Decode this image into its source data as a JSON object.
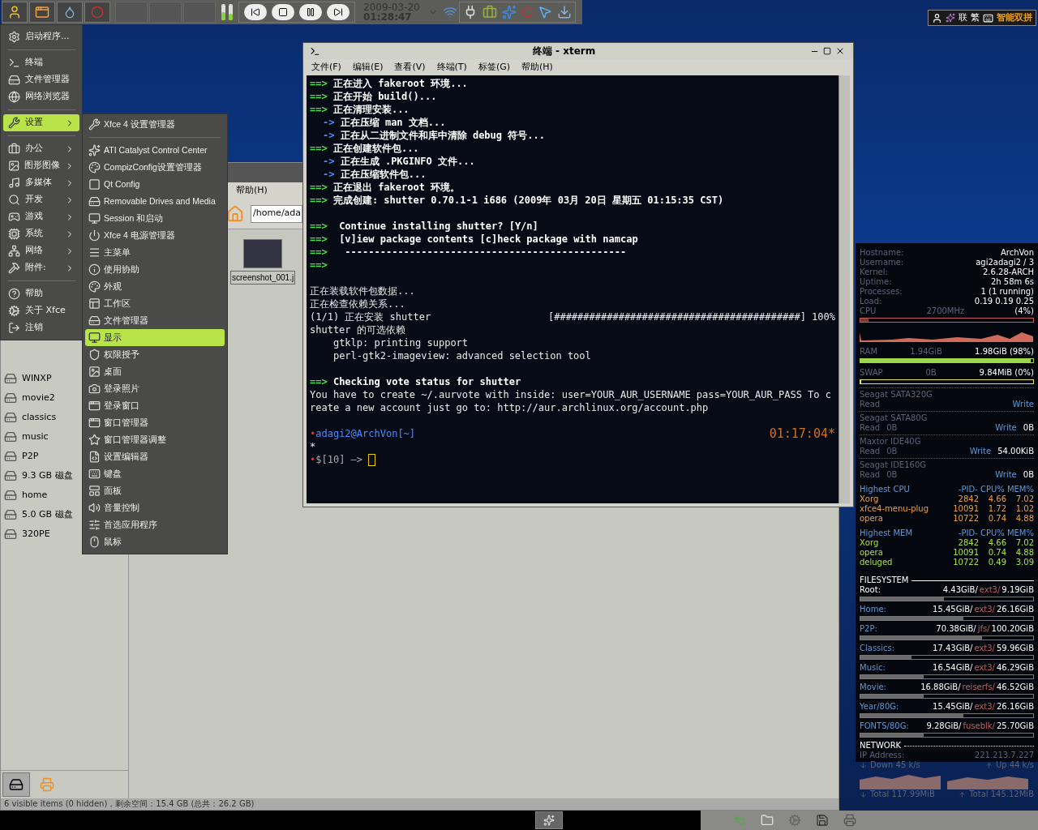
{
  "top_panel": {
    "date": "2009-03-20",
    "time": "01:28:47",
    "ime": {
      "chars": [
        "联",
        "繁"
      ],
      "mode": "智能双拼"
    }
  },
  "app_menu": {
    "items": [
      {
        "kind": "item",
        "label": "启动程序...",
        "selected": false,
        "submenu": false
      },
      {
        "kind": "separator"
      },
      {
        "kind": "item",
        "label": "终端",
        "selected": false,
        "submenu": false
      },
      {
        "kind": "item",
        "label": "文件管理器",
        "selected": false,
        "submenu": false
      },
      {
        "kind": "item",
        "label": "网络浏览器",
        "selected": false,
        "submenu": false
      },
      {
        "kind": "separator"
      },
      {
        "kind": "item",
        "label": "设置",
        "selected": true,
        "submenu": true
      },
      {
        "kind": "separator"
      },
      {
        "kind": "item",
        "label": "办公",
        "selected": false,
        "submenu": true
      },
      {
        "kind": "item",
        "label": "图形图像",
        "selected": false,
        "submenu": true
      },
      {
        "kind": "item",
        "label": "多媒体",
        "selected": false,
        "submenu": true
      },
      {
        "kind": "item",
        "label": "开发",
        "selected": false,
        "submenu": true
      },
      {
        "kind": "item",
        "label": "游戏",
        "selected": false,
        "submenu": true
      },
      {
        "kind": "item",
        "label": "系统",
        "selected": false,
        "submenu": true
      },
      {
        "kind": "item",
        "label": "网络",
        "selected": false,
        "submenu": true
      },
      {
        "kind": "item",
        "label": "附件:",
        "selected": false,
        "submenu": true
      },
      {
        "kind": "separator"
      },
      {
        "kind": "item",
        "label": "帮助",
        "selected": false,
        "submenu": false
      },
      {
        "kind": "item",
        "label": "关于 Xfce",
        "selected": false,
        "submenu": false
      },
      {
        "kind": "item",
        "label": "注销",
        "selected": false,
        "submenu": false
      }
    ]
  },
  "settings_menu": {
    "items": [
      {
        "kind": "item",
        "label": "Xfce 4 设置管理器",
        "selected": false
      },
      {
        "kind": "separator"
      },
      {
        "kind": "item",
        "label": "ATI Catalyst Control Center",
        "selected": false
      },
      {
        "kind": "item",
        "label": "CompizConfig设置管理器",
        "selected": false
      },
      {
        "kind": "item",
        "label": "Qt Config",
        "selected": false
      },
      {
        "kind": "item",
        "label": "Removable Drives and Media",
        "selected": false
      },
      {
        "kind": "item",
        "label": "Session 和启动",
        "selected": false
      },
      {
        "kind": "item",
        "label": "Xfce 4 电源管理器",
        "selected": false
      },
      {
        "kind": "item",
        "label": "主菜单",
        "selected": false
      },
      {
        "kind": "item",
        "label": "使用协助",
        "selected": false
      },
      {
        "kind": "item",
        "label": "外观",
        "selected": false
      },
      {
        "kind": "item",
        "label": "工作区",
        "selected": false
      },
      {
        "kind": "item",
        "label": "文件管理器",
        "selected": false
      },
      {
        "kind": "item",
        "label": "显示",
        "selected": true
      },
      {
        "kind": "item",
        "label": "权限授予",
        "selected": false
      },
      {
        "kind": "item",
        "label": "桌面",
        "selected": false
      },
      {
        "kind": "item",
        "label": "登录照片",
        "selected": false
      },
      {
        "kind": "item",
        "label": "登录窗口",
        "selected": false
      },
      {
        "kind": "item",
        "label": "窗口管理器",
        "selected": false
      },
      {
        "kind": "item",
        "label": "窗口管理器调整",
        "selected": false
      },
      {
        "kind": "item",
        "label": "设置编辑器",
        "selected": false
      },
      {
        "kind": "item",
        "label": "键盘",
        "selected": false
      },
      {
        "kind": "item",
        "label": "面板",
        "selected": false
      },
      {
        "kind": "item",
        "label": "音量控制",
        "selected": false
      },
      {
        "kind": "item",
        "label": "首选应用程序",
        "selected": false
      },
      {
        "kind": "item",
        "label": "鼠标",
        "selected": false
      }
    ]
  },
  "file_manager": {
    "menu": [
      "帮助(H)"
    ],
    "location": "/home/ada",
    "drives": [
      "WINXP",
      "movie2",
      "classics",
      "music",
      "P2P",
      "9.3 GB 磁盘",
      "home",
      "5.0 GB 磁盘",
      "320PE"
    ],
    "files": [
      "screenshot_001.j"
    ],
    "status": "6 visible items (0 hidden)，剩余空间：15.4 GB (总共：26.2 GB)"
  },
  "terminal": {
    "title": "终端 - xterm",
    "menu": [
      "文件(F)",
      "编辑(E)",
      "查看(V)",
      "终端(T)",
      "标签(G)",
      "帮助(H)"
    ],
    "lines": [
      {
        "kind": "main",
        "arrow": "==>",
        "text": "正在进入 fakeroot 环境..."
      },
      {
        "kind": "main",
        "arrow": "==>",
        "text": "正在开始 build()..."
      },
      {
        "kind": "main",
        "arrow": "==>",
        "text": "正在清理安装..."
      },
      {
        "kind": "sub",
        "arrow": "->",
        "text": "正在压缩 man 文档..."
      },
      {
        "kind": "sub",
        "arrow": "->",
        "text": "正在从二进制文件和库中清除 debug 符号..."
      },
      {
        "kind": "main",
        "arrow": "==>",
        "text": "正在创建软件包..."
      },
      {
        "kind": "sub",
        "arrow": "->",
        "text": "正在生成 .PKGINFO 文件..."
      },
      {
        "kind": "sub",
        "arrow": "->",
        "text": "正在压缩软件包..."
      },
      {
        "kind": "main",
        "arrow": "==>",
        "text": "正在退出 fakeroot 环境。"
      },
      {
        "kind": "main",
        "arrow": "==>",
        "text": "完成创建: shutter 0.70.1-1 i686 (2009年 03月 20日 星期五 01:15:35 CST)"
      },
      {
        "kind": "blank"
      },
      {
        "kind": "main",
        "arrow": "==>",
        "text": " Continue installing shutter? [Y/n]"
      },
      {
        "kind": "main",
        "arrow": "==>",
        "text": " [v]iew package contents [c]heck package with namcap"
      },
      {
        "kind": "main",
        "arrow": "==>",
        "text": "  ------------------------------------------------"
      },
      {
        "kind": "main",
        "arrow": "==>"
      },
      {
        "kind": "blank"
      },
      {
        "kind": "plain",
        "text": "正在装载软件包数据..."
      },
      {
        "kind": "plain",
        "text": "正在检查依赖关系..."
      },
      {
        "kind": "progress",
        "text": "(1/1) 正在安装 shutter",
        "bar": "[##########################################]",
        "percent": "100%"
      },
      {
        "kind": "plain",
        "text": "shutter 的可选依赖"
      },
      {
        "kind": "plain",
        "text": "    gtklp: printing support"
      },
      {
        "kind": "plain",
        "text": "    perl-gtk2-imageview: advanced selection tool"
      },
      {
        "kind": "blank"
      },
      {
        "kind": "main",
        "arrow": "==>",
        "text": "Checking vote status for shutter"
      },
      {
        "kind": "plain",
        "text": "You have to create ~/.aurvote with inside: user=YOUR_AUR_USERNAME pass=YOUR_AUR_PASS To create a new account just go to: http://aur.archlinux.org/account.php"
      },
      {
        "kind": "blank"
      },
      {
        "kind": "prompt",
        "mark": "•",
        "text": "adagi2@ArchVon[~]",
        "right": "01:17:04*"
      },
      {
        "kind": "plain",
        "text": "*"
      },
      {
        "kind": "input",
        "mark": "•",
        "text": "$[10] —>"
      }
    ]
  },
  "conky": {
    "system": [
      {
        "label": "Hostname:",
        "value": "ArchVon"
      },
      {
        "label": "Username:",
        "value": "agi2adagi2 / 3"
      },
      {
        "label": "Kernel:",
        "value": "2.6.28-ARCH"
      },
      {
        "label": "Uptime:",
        "value": "2h 58m 6s"
      },
      {
        "label": "Processes:",
        "value": "1 (1 running)"
      },
      {
        "label": "Load:",
        "value": "0.19 0.19 0.25"
      }
    ],
    "cpu": {
      "label": "CPU",
      "freq": "2700MHz",
      "percent": "(4%)",
      "level": 0.04
    },
    "ram": {
      "label": "RAM",
      "used": "1.94GiB",
      "total": "1.98GiB (98%)",
      "level": 0.98
    },
    "swap": {
      "label": "SWAP",
      "used": "0B",
      "total": "9.84MiB (0%)",
      "level": 0
    },
    "disks": [
      {
        "name": "Seagat SATA320G",
        "read_label": "Read",
        "write_label": "Write"
      },
      {
        "name": "Seagat SATA80G",
        "read_label": "Read",
        "read": "0B",
        "write_label": "Write",
        "write": "0B"
      },
      {
        "name": "Maxtor IDE40G",
        "read_label": "Read",
        "read": "0B",
        "write_label": "Write",
        "write": "54.00KiB"
      },
      {
        "name": "Seagat IDE160G",
        "read_label": "Read",
        "read": "0B",
        "write_label": "Write",
        "write": "0B"
      }
    ],
    "top_cpu": {
      "title": "Highest CPU",
      "header": "-PID- CPU% MEM%",
      "rows": [
        {
          "name": "Xorg",
          "pid": "2842",
          "cpu": "4.66",
          "mem": "7.02"
        },
        {
          "name": "xfce4-menu-plug",
          "pid": "10091",
          "cpu": "1.72",
          "mem": "1.02"
        },
        {
          "name": "opera",
          "pid": "10722",
          "cpu": "0.74",
          "mem": "4.88"
        }
      ]
    },
    "top_mem": {
      "title": "Highest MEM",
      "header": "-PID- CPU% MEM%",
      "rows": [
        {
          "name": "Xorg",
          "pid": "2842",
          "cpu": "4.66",
          "mem": "7.02"
        },
        {
          "name": "opera",
          "pid": "10091",
          "cpu": "0.74",
          "mem": "4.88"
        },
        {
          "name": "deluged",
          "pid": "10722",
          "cpu": "0.49",
          "mem": "3.09"
        }
      ]
    },
    "filesystem": {
      "title": "FILESYSTEM",
      "mounts": [
        {
          "name": "Root:",
          "used": "4.43GiB/",
          "fs": "ext3/",
          "size": "9.19GiB",
          "level": 0.48
        },
        {
          "name": "Home:",
          "used": "15.45GiB/",
          "fs": "ext3/",
          "size": "26.16GiB",
          "level": 0.59
        },
        {
          "name": "P2P:",
          "used": "70.38GiB/",
          "fs": "jfs/",
          "size": "100.20GiB",
          "level": 0.7
        },
        {
          "name": "Classics:",
          "used": "17.43GiB/",
          "fs": "ext3/",
          "size": "59.96GiB",
          "level": 0.29
        },
        {
          "name": "Music:",
          "used": "16.54GiB/",
          "fs": "ext3/",
          "size": "46.29GiB",
          "level": 0.36
        },
        {
          "name": "Movie:",
          "used": "16.88GiB/",
          "fs": "reiserfs/",
          "size": "46.52GiB",
          "level": 0.36
        },
        {
          "name": "Year/80G:",
          "used": "15.45GiB/",
          "fs": "ext3/",
          "size": "26.16GiB",
          "level": 0.59
        },
        {
          "name": "FONTS/80G:",
          "used": "9.28GiB/",
          "fs": "fuseblk/",
          "size": "25.70GiB",
          "level": 0.36
        }
      ]
    },
    "network": {
      "title": "NETWORK",
      "ip_label": "IP Address:",
      "ip": "221.213.7.227",
      "down": "Down 45 k/s",
      "up": "Up 44 k/s",
      "down_total": "Total 117.99MiB",
      "up_total": "Total 145.12MiB"
    }
  }
}
